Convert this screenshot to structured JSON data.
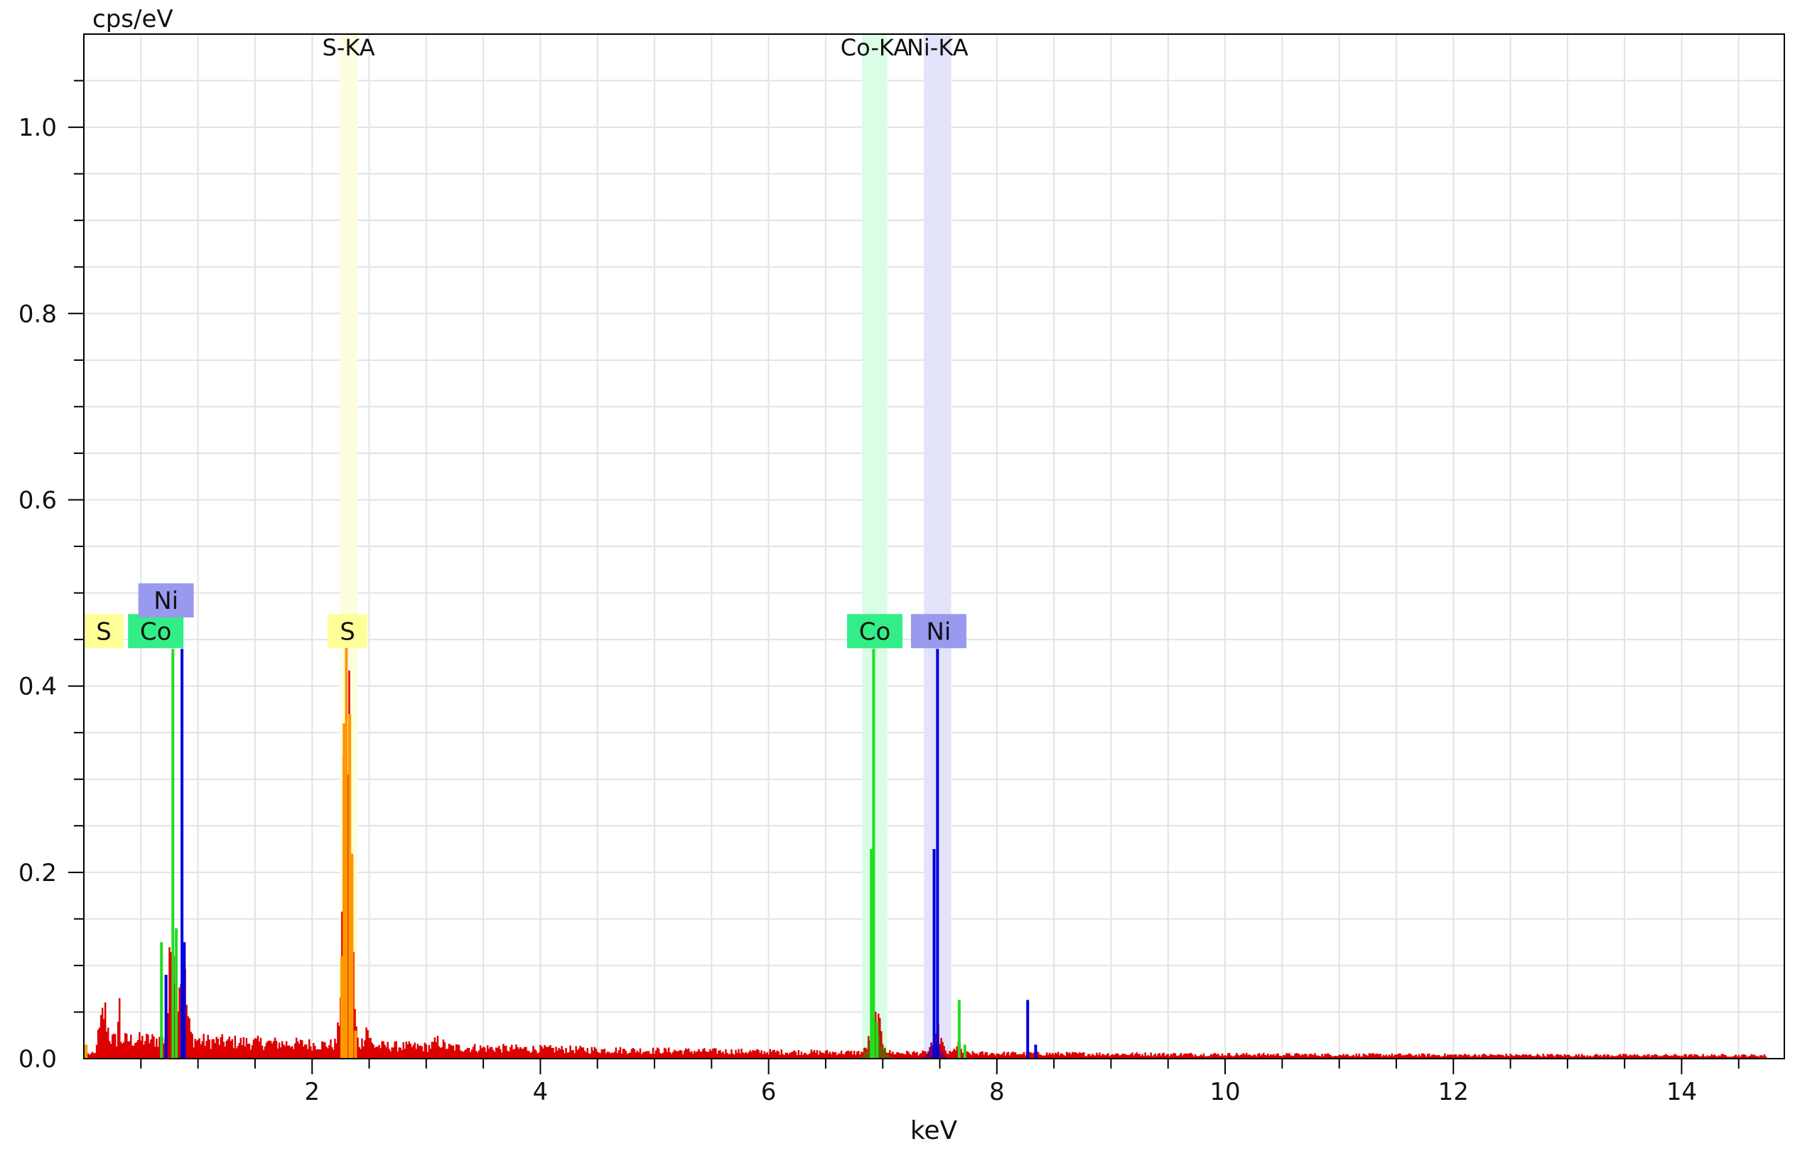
{
  "chart_data": {
    "type": "bar",
    "title": "",
    "xlabel": "keV",
    "ylabel": "cps/eV",
    "xlim": [
      0,
      14.9
    ],
    "ylim": [
      0,
      1.1
    ],
    "x_ticks": [
      {
        "value": 2,
        "label": "2"
      },
      {
        "value": 4,
        "label": "4"
      },
      {
        "value": 6,
        "label": "6"
      },
      {
        "value": 8,
        "label": "8"
      },
      {
        "value": 10,
        "label": "10"
      },
      {
        "value": 12,
        "label": "12"
      },
      {
        "value": 14,
        "label": "14"
      }
    ],
    "y_ticks": [
      {
        "value": 0.0,
        "label": "0.0"
      },
      {
        "value": 0.2,
        "label": "0.2"
      },
      {
        "value": 0.4,
        "label": "0.4"
      },
      {
        "value": 0.6,
        "label": "0.6"
      },
      {
        "value": 0.8,
        "label": "0.8"
      },
      {
        "value": 1.0,
        "label": "1.0"
      }
    ],
    "grid": true,
    "colors": {
      "spectrum": "#dd0000",
      "S": "#ffff99",
      "Co": "#33ee88",
      "Ni": "#9999ee",
      "S_line": "#ff9900",
      "Co_line": "#22dd22",
      "Ni_line": "#0000dd",
      "grid": "#e3e3e3",
      "axis": "#000000"
    },
    "element_bands": [
      {
        "label": "S-KA",
        "element": "S",
        "x0": 2.24,
        "x1": 2.4,
        "band_color": "#fffde0"
      },
      {
        "label": "Co-KA",
        "element": "Co",
        "x0": 6.82,
        "x1": 7.04,
        "band_color": "#d9fde5"
      },
      {
        "label": "Ni-KA",
        "element": "Ni",
        "x0": 7.36,
        "x1": 7.6,
        "band_color": "#e3e3fb"
      }
    ],
    "element_markers": [
      {
        "label": "S",
        "x": 0.0,
        "y": 0.459,
        "element": "S"
      },
      {
        "label": "Co",
        "x": 0.63,
        "y": 0.459,
        "element": "Co"
      },
      {
        "label": "Ni",
        "x": 0.72,
        "y": 0.492,
        "element": "Ni"
      },
      {
        "label": "S",
        "x": 2.31,
        "y": 0.459,
        "element": "S"
      },
      {
        "label": "Co",
        "x": 6.93,
        "y": 0.459,
        "element": "Co"
      },
      {
        "label": "Ni",
        "x": 7.49,
        "y": 0.459,
        "element": "Ni"
      }
    ],
    "series": [
      {
        "name": "S",
        "color": "#ff9900",
        "lines": [
          [
            2.28,
            0.36
          ],
          [
            2.3,
            0.44
          ],
          [
            2.33,
            0.37
          ],
          [
            2.35,
            0.22
          ],
          [
            2.26,
            0.11
          ],
          [
            2.38,
            0.03
          ],
          [
            0.02,
            0.015
          ]
        ]
      },
      {
        "name": "Co",
        "color": "#22dd22",
        "lines": [
          [
            0.78,
            0.44
          ],
          [
            0.68,
            0.125
          ],
          [
            0.81,
            0.14
          ],
          [
            6.92,
            0.44
          ],
          [
            6.9,
            0.225
          ],
          [
            6.95,
            0.04
          ],
          [
            7.67,
            0.063
          ],
          [
            7.72,
            0.015
          ]
        ]
      },
      {
        "name": "Ni",
        "color": "#0000dd",
        "lines": [
          [
            0.86,
            0.44
          ],
          [
            0.72,
            0.09
          ],
          [
            0.88,
            0.125
          ],
          [
            7.48,
            0.44
          ],
          [
            7.45,
            0.225
          ],
          [
            8.27,
            0.063
          ],
          [
            8.34,
            0.015
          ]
        ]
      }
    ]
  }
}
